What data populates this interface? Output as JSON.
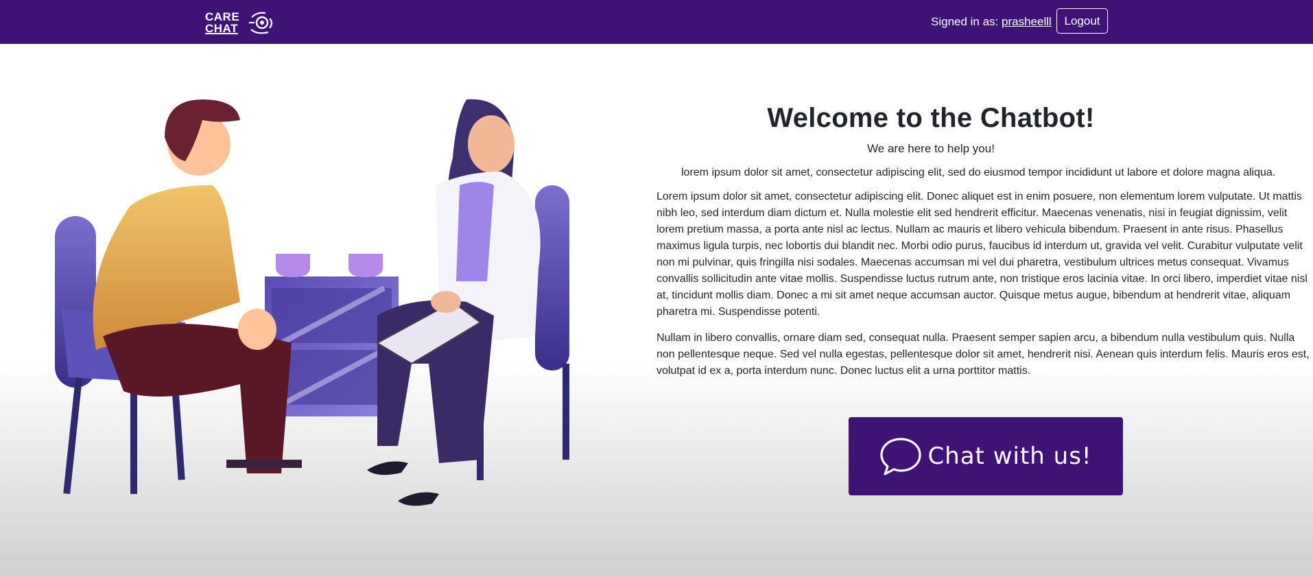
{
  "brand": {
    "line1": "CARE",
    "line2": "CHAT"
  },
  "nav": {
    "signed_in_prefix": "Signed in as:",
    "username": "prasheelll",
    "logout_label": "Logout"
  },
  "main": {
    "heading": "Welcome to the Chatbot!",
    "tagline": "We are here to help you!",
    "lead": "lorem ipsum dolor sit amet, consectetur adipiscing elit, sed do eiusmod tempor incididunt ut labore et dolore magna aliqua.",
    "paragraph1": "Lorem ipsum dolor sit amet, consectetur adipiscing elit. Donec aliquet est in enim posuere, non elementum lorem vulputate. Ut mattis nibh leo, sed interdum diam dictum et. Nulla molestie elit sed hendrerit efficitur. Maecenas venenatis, nisi in feugiat dignissim, velit lorem pretium massa, a porta ante nisl ac lectus. Nullam ac mauris et libero vehicula bibendum. Praesent in ante risus. Phasellus maximus ligula turpis, nec lobortis dui blandit nec. Morbi odio purus, faucibus id interdum ut, gravida vel velit. Curabitur vulputate velit non mi pulvinar, quis fringilla nisi sodales. Maecenas accumsan mi vel dui pharetra, vestibulum ultrices metus consequat. Vivamus convallis sollicitudin ante vitae mollis. Suspendisse luctus rutrum ante, non tristique eros lacinia vitae. In orci libero, imperdiet vitae nisl at, tincidunt mollis diam. Donec a mi sit amet neque accumsan auctor. Quisque metus augue, bibendum at hendrerit vitae, aliquam pharetra mi. Suspendisse potenti.",
    "paragraph2": "Nullam in libero convallis, ornare diam sed, consequat nulla. Praesent semper sapien arcu, a bibendum nulla vestibulum quis. Nulla non pellentesque neque. Sed vel nulla egestas, pellentesque dolor sit amet, hendrerit nisi. Aenean quis interdum felis. Mauris eros est, volutpat id ex a, porta interdum nunc. Donec luctus elit a urna porttitor mattis.",
    "chat_button_label": "Chat with us!"
  },
  "icons": {
    "brand_logo": "stethoscope-heart-icon",
    "chat_button": "speech-bubble-icon"
  },
  "colors": {
    "navbar": "#3f1275",
    "chat_button": "#3f1275",
    "text": "#212529"
  }
}
